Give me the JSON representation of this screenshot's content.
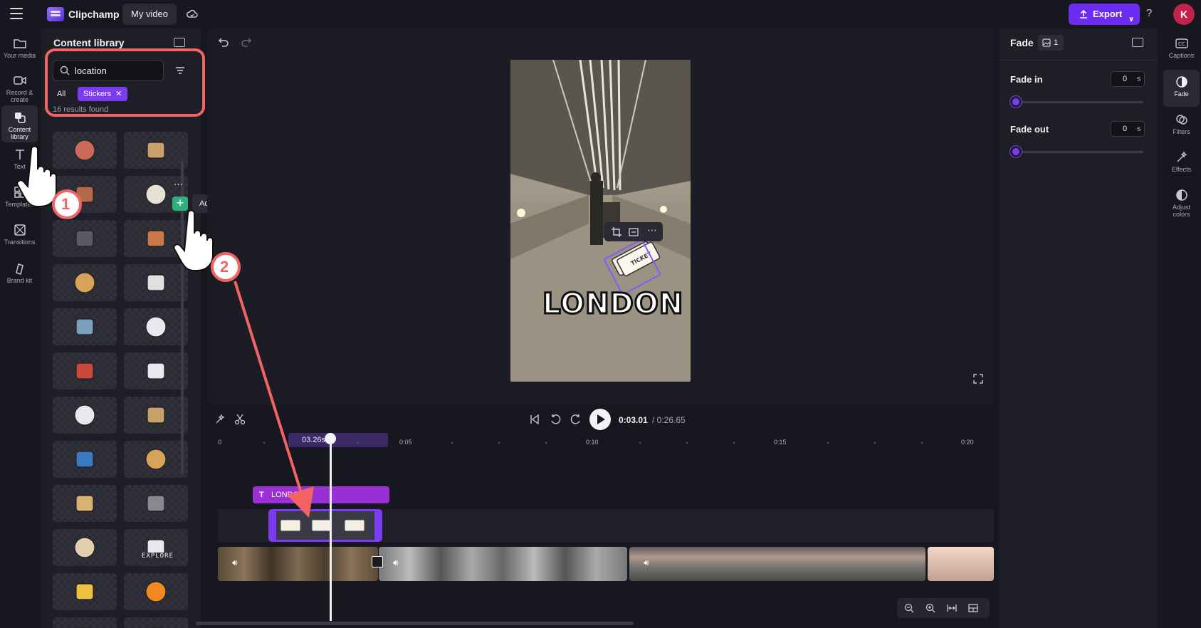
{
  "header": {
    "app_name": "Clipchamp",
    "project_name": "My video",
    "export_label": "Export",
    "help": "?",
    "avatar_initial": "K"
  },
  "left_rail": {
    "items": [
      {
        "label": "Your media",
        "icon": "folder-icon"
      },
      {
        "label": "Record & create",
        "icon": "camera-icon"
      },
      {
        "label": "Content library",
        "icon": "content-library-icon",
        "active": true
      },
      {
        "label": "Text",
        "icon": "text-icon"
      },
      {
        "label": "Templates",
        "icon": "templates-icon"
      },
      {
        "label": "Transitions",
        "icon": "transitions-icon"
      },
      {
        "label": "Brand kit",
        "icon": "brand-kit-icon"
      }
    ]
  },
  "library": {
    "title": "Content library",
    "search_value": "location",
    "chip_all": "All",
    "chip_stickers": "Stickers",
    "results_text": "16 results found",
    "tooltip": "Add to timeline",
    "stickers": [
      "people-sticker",
      "suitcase-sticker",
      "backpack-sticker",
      "tickets-sticker",
      "eiffel-tower-sticker",
      "handbag-sticker",
      "hot-air-balloon-sticker",
      "airplane-sticker",
      "luggage-sticker",
      "ship-sticker",
      "train-sticker",
      "cruise-ship-sticker",
      "jet-sticker",
      "suitcase-sticker",
      "globe-sticker",
      "big-ben-sticker",
      "pisa-tower-sticker",
      "plane-outline-sticker",
      "map-sticker",
      "explore-sticker",
      "taxi-sticker",
      "orange-suitcase-sticker",
      "balloon-sticker",
      "misc-sticker"
    ],
    "explore_text": "EXPLORE"
  },
  "preview": {
    "overlay_text": "LONDON"
  },
  "playback": {
    "current_time": "0:03.01",
    "total_time": "/ 0:26.65"
  },
  "timeline": {
    "playhead_label": "03.26s",
    "ruler": [
      "0",
      "0:05",
      "0:10",
      "0:15",
      "0:20"
    ],
    "text_clip_label": "LONDON"
  },
  "props": {
    "title": "Fade",
    "count": "1",
    "fade_in_label": "Fade in",
    "fade_in_value": "0",
    "fade_out_label": "Fade out",
    "fade_out_value": "0",
    "unit": "s"
  },
  "right_rail": {
    "items": [
      {
        "label": "Captions",
        "icon": "captions-icon"
      },
      {
        "label": "Fade",
        "icon": "fade-icon",
        "active": true
      },
      {
        "label": "Filters",
        "icon": "filters-icon"
      },
      {
        "label": "Effects",
        "icon": "effects-icon"
      },
      {
        "label": "Adjust colors",
        "icon": "adjust-colors-icon"
      }
    ]
  },
  "annotations": {
    "step1": "1",
    "step2": "2"
  },
  "colors": {
    "accent": "#7b3bf0",
    "highlight": "#f26464",
    "add_green": "#2fae7e",
    "text_clip": "#9b2fd6"
  }
}
